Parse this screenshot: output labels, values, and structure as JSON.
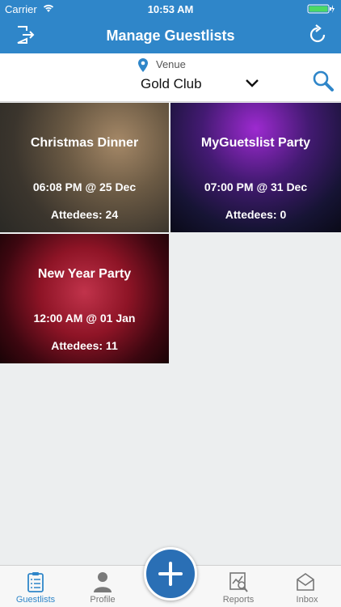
{
  "status": {
    "carrier": "Carrier",
    "time": "10:53 AM"
  },
  "nav": {
    "title": "Manage Guestlists",
    "left_icon": "logout-icon",
    "right_icon": "refresh-icon"
  },
  "venue": {
    "label": "Venue",
    "value": "Gold Club"
  },
  "events": [
    {
      "name": "Christmas Dinner",
      "when": "06:08 PM @ 25 Dec",
      "attendees": "Attedees: 24"
    },
    {
      "name": "MyGuetslist Party",
      "when": "07:00 PM @ 31 Dec",
      "attendees": "Attedees: 0"
    },
    {
      "name": "New Year Party",
      "when": "12:00 AM @ 01 Jan",
      "attendees": "Attedees: 11"
    }
  ],
  "tabs": [
    {
      "label": "Guestlists",
      "icon": "clipboard-icon",
      "active": true
    },
    {
      "label": "Profile",
      "icon": "person-icon",
      "active": false
    },
    {
      "label": "Reports",
      "icon": "report-icon",
      "active": false
    },
    {
      "label": "Inbox",
      "icon": "envelope-icon",
      "active": false
    }
  ],
  "fab_icon": "plus-icon",
  "colors": {
    "primary": "#2f86c9",
    "fab": "#2a6fb5",
    "background": "#eceeef"
  }
}
